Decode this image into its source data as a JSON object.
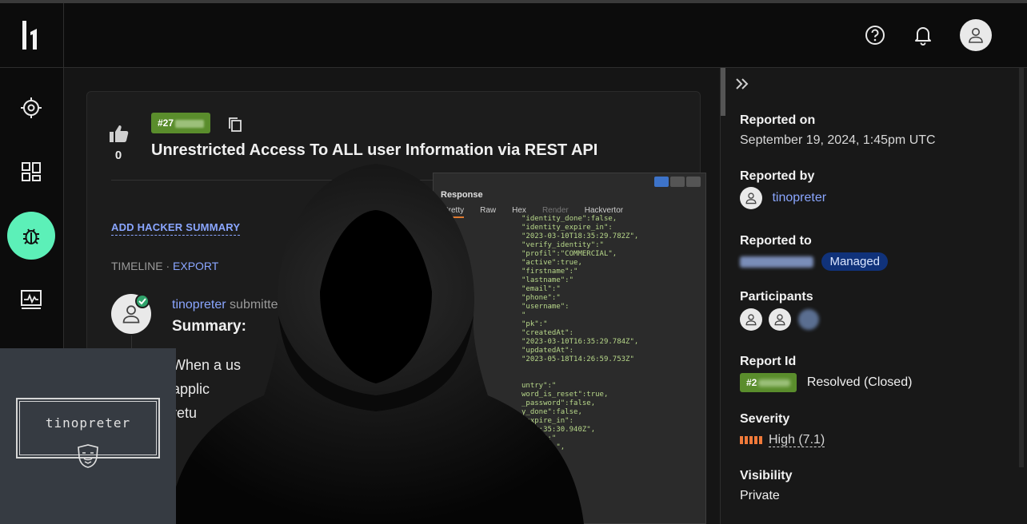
{
  "topbar": {
    "icons": [
      "help-icon",
      "bell-icon",
      "profile-avatar"
    ]
  },
  "leftnav": {
    "items": [
      "target-icon",
      "dashboard-icon",
      "bug-icon",
      "activity-icon"
    ],
    "active": "bug-icon",
    "accent": "#5cf0b8"
  },
  "report": {
    "votes": "0",
    "id_prefix": "#27",
    "title": "Unrestricted Access To ALL user Information via REST API",
    "add_summary": "ADD HACKER SUMMARY",
    "timeline": "TIMELINE",
    "timeline_sep": " · ",
    "export": "EXPORT",
    "submitter": "tinopreter",
    "submitted_text": " submitte",
    "summary_heading": "Summary:",
    "body_lines": [
      "When a us",
      "applic",
      "retu"
    ]
  },
  "side": {
    "reported_on_label": "Reported on",
    "reported_on_value": "September 19, 2024, 1:45pm UTC",
    "reported_by_label": "Reported by",
    "reported_by_value": "tinopreter",
    "reported_to_label": "Reported to",
    "managed_badge": "Managed",
    "participants_label": "Participants",
    "report_id_label": "Report Id",
    "report_id_prefix": "#2",
    "status": "Resolved (Closed)",
    "severity_label": "Severity",
    "severity_value": "High (7.1)",
    "visibility_label": "Visibility",
    "visibility_value": "Private"
  },
  "burp": {
    "title": "Response",
    "tabs": [
      "Pretty",
      "Raw",
      "Hex",
      "Render",
      "Hackvertor"
    ],
    "lines": [
      "\"identity_done\":false,",
      "\"identity_expire_in\":",
      "\"2023-03-10T18:35:29.782Z\",",
      "\"verify_identity\":\"",
      "\"profil\":\"COMMERCIAL\",",
      "\"active\":true,",
      "\"firstname\":\"",
      "\"lastname\":\"",
      "\"email\":\"",
      "\"phone\":\"",
      "\"username\":",
      "\"",
      "\"pk\":\"",
      "\"createdAt\":",
      "\"2023-03-10T16:35:29.784Z\",",
      "\"updatedAt\":",
      "\"2023-05-18T14:26:59.753Z\"",
      "",
      "",
      "untry\":\"",
      "word_is_reset\":true,",
      "_password\":false,",
      "y_done\":false,",
      "_expire_in\":",
      "0T18:35:30.940Z\",",
      "ntity\":\"",
      "MMERCIAL\","
    ]
  },
  "watermark": {
    "text": "tinopreter"
  }
}
